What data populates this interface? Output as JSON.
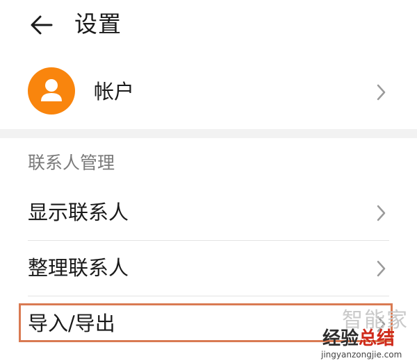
{
  "header": {
    "back_icon": "arrow-left-icon",
    "title": "设置"
  },
  "account": {
    "avatar_icon": "person-icon",
    "avatar_color": "#f9850d",
    "label": "帐户",
    "chevron_icon": "chevron-right-icon"
  },
  "contacts_management": {
    "section_title": "联系人管理",
    "items": [
      {
        "label": "显示联系人",
        "chevron_icon": "chevron-right-icon"
      },
      {
        "label": "整理联系人",
        "chevron_icon": "chevron-right-icon"
      },
      {
        "label": "导入/导出",
        "chevron_icon": "chevron-right-icon",
        "highlighted": true
      }
    ]
  },
  "highlight_color": "#d97a52",
  "watermark": {
    "faint_text": "智能家",
    "cn_text_part1": "经验",
    "cn_text_part2": "总结",
    "en_text": "jingyanzongjie.com"
  }
}
